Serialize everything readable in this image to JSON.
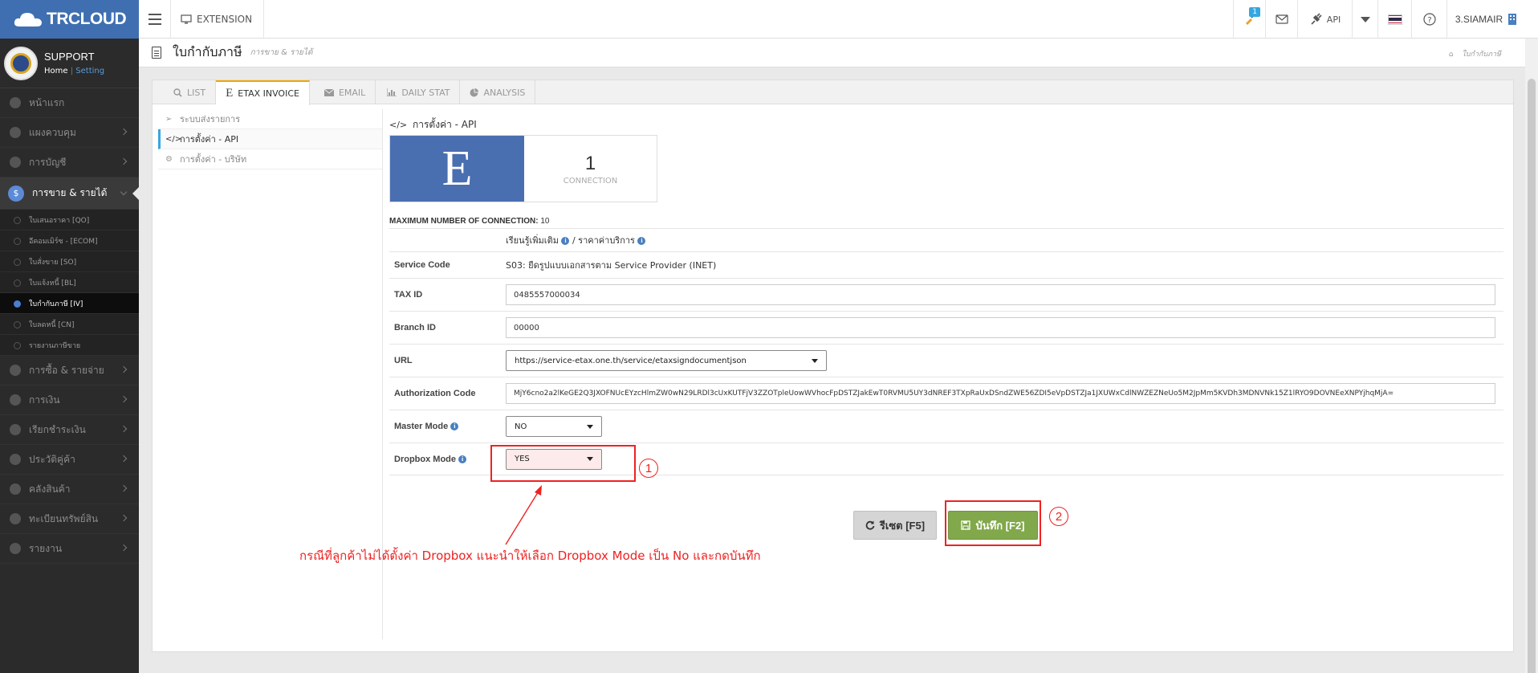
{
  "brand": {
    "name": "TRCLOUD"
  },
  "topbar": {
    "extension_label": "EXTENSION",
    "notification_count": "1",
    "api_label": "API",
    "user_label": "3.SIAMAIR"
  },
  "sidebar": {
    "profile_name": "SUPPORT",
    "home_link": "Home",
    "setting_link": "Setting",
    "menu_top": [
      {
        "label": "หน้าแรก",
        "icon": "cloud-icon"
      },
      {
        "label": "แผงควบคุม",
        "icon": "monitor-icon"
      },
      {
        "label": "การบัญชี",
        "icon": "book-icon"
      }
    ],
    "active_menu": {
      "label": "การขาย & รายได้",
      "icon": "dollar-icon"
    },
    "submenu": [
      {
        "label": "ใบเสนอราคา [QO]"
      },
      {
        "label": "อีคอมเมิร์ซ - [ECOM]"
      },
      {
        "label": "ใบสั่งขาย [SO]"
      },
      {
        "label": "ใบแจ้งหนี้ [BL]"
      },
      {
        "label": "ใบกำกับภาษี [IV]"
      },
      {
        "label": "ใบลดหนี้ [CN]"
      },
      {
        "label": "รายงานภาษีขาย"
      }
    ],
    "menu_bottom": [
      {
        "label": "การซื้อ & รายจ่าย",
        "icon": "cart-icon"
      },
      {
        "label": "การเงิน",
        "icon": "calendar-icon"
      },
      {
        "label": "เรียกชำระเงิน",
        "icon": "card-icon"
      },
      {
        "label": "ประวัติคู่ค้า",
        "icon": "contact-icon"
      },
      {
        "label": "คลังสินค้า",
        "icon": "cubes-icon"
      },
      {
        "label": "ทะเบียนทรัพย์สิน",
        "icon": "globe-icon"
      },
      {
        "label": "รายงาน",
        "icon": "report-icon"
      }
    ]
  },
  "page": {
    "title": "ใบกำกับภาษี",
    "subtitle": "การขาย & รายได้",
    "breadcrumb": "ใบกำกับภาษี"
  },
  "tabs": [
    {
      "label": "LIST",
      "icon": "search-icon"
    },
    {
      "label": "ETAX INVOICE",
      "icon": "e-icon"
    },
    {
      "label": "EMAIL",
      "icon": "envelope-icon"
    },
    {
      "label": "DAILY STAT",
      "icon": "chart-icon"
    },
    {
      "label": "ANALYSIS",
      "icon": "pie-icon"
    }
  ],
  "subnav": [
    {
      "label": "ระบบส่งรายการ",
      "icon": "paper-plane-icon"
    },
    {
      "label": "การตั้งค่า - API",
      "icon": "code-icon"
    },
    {
      "label": "การตั้งค่า - บริษัท",
      "icon": "gear-icon"
    }
  ],
  "content": {
    "section_title": "การตั้งค่า - API",
    "logo_letter": "E",
    "connection_count": "1",
    "connection_label": "CONNECTION",
    "max_conn_label": "MAXIMUM NUMBER OF CONNECTION:",
    "max_conn_value": "10",
    "learn_more": "เรียนรู้เพิ่มเติม",
    "pricing": "ราคาค่าบริการ",
    "service_code_label": "Service Code",
    "service_code_value": "S03: ยืดรูปแบบเอกสารตาม Service Provider (INET)",
    "tax_id_label": "TAX ID",
    "tax_id_value": "0485557000034",
    "branch_id_label": "Branch ID",
    "branch_id_value": "00000",
    "url_label": "URL",
    "url_value": "https://service-etax.one.th/service/etaxsigndocumentjson",
    "auth_label": "Authorization Code",
    "auth_value": "MjY6cno2a2lKeGE2Q3JXOFNUcEYzcHlmZW0wN29LRDl3cUxKUTFjV3ZZOTpleUowWVhocFpDSTZJakEwT0RVMU5UY3dNREF3TXpRaUxDSndZWE56ZDI5eVpDSTZJa1JXUWxCdlNWZEZNeUo5M2JpMm5KVDh3MDNVNk15Z1lRYO9DOVNEeXNPYjhqMjA=",
    "master_mode_label": "Master Mode",
    "master_mode_value": "NO",
    "dropbox_mode_label": "Dropbox Mode",
    "dropbox_mode_value": "YES",
    "reset_label": "รีเซต [F5]",
    "save_label": "บันทึก [F2]"
  },
  "annotation": {
    "marker_1": "1",
    "marker_2": "2",
    "note": "กรณีที่ลูกค้าไม่ได้ตั้งค่า Dropbox แนะนำให้เลือก Dropbox Mode เป็น No และกดบันทึก",
    "color": "#ee2222"
  }
}
